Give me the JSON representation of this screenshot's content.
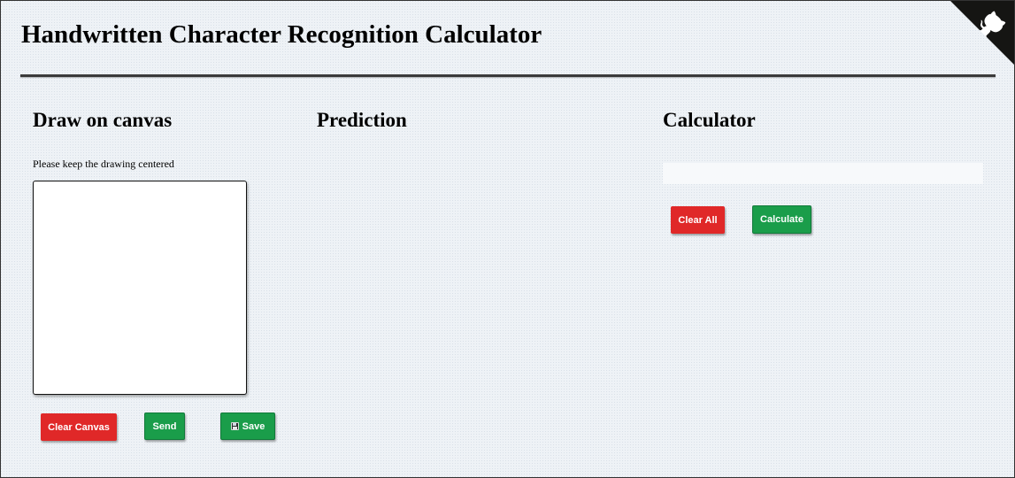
{
  "header": {
    "title": "Handwritten Character Recognition Calculator"
  },
  "draw_section": {
    "heading": "Draw on canvas",
    "hint": "Please keep the drawing centered",
    "buttons": {
      "clear_canvas": "Clear Canvas",
      "send": "Send",
      "save": "Save"
    }
  },
  "prediction_section": {
    "heading": "Prediction"
  },
  "calculator_section": {
    "heading": "Calculator",
    "display_value": "",
    "buttons": {
      "clear_all": "Clear All",
      "calculate": "Calculate"
    }
  },
  "icons": {
    "github_corner": "github-octocat-icon",
    "save": "floppy-disk-icon"
  },
  "colors": {
    "danger": "#e02828",
    "success": "#1a9d4a"
  }
}
